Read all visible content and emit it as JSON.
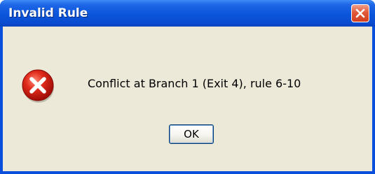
{
  "dialog": {
    "title": "Invalid Rule",
    "message": "Conflict at Branch 1 (Exit 4), rule 6-10",
    "ok_label": "OK",
    "icon": "error-icon",
    "close_icon": "close-icon"
  },
  "colors": {
    "titlebar": "#0a55db",
    "client_bg": "#ece9d8",
    "close_button": "#e2583a",
    "error_icon": "#d81b14"
  }
}
